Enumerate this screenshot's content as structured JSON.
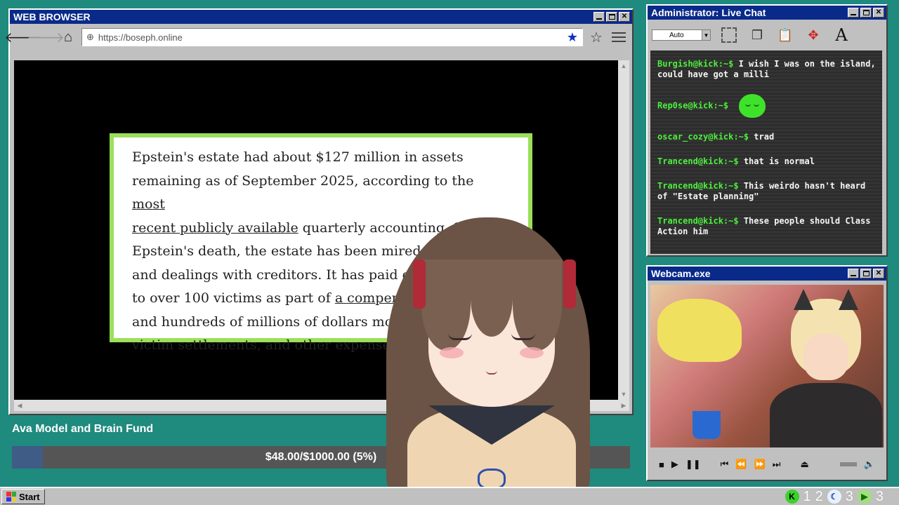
{
  "browser": {
    "title": "WEB BROWSER",
    "url": "https://boseph.online",
    "article": {
      "line1": "Epstein's estate had about $127 million in assets",
      "line2_a": "remaining as of September 2025, according to the ",
      "line2_link": "most",
      "line3_link": "recent publicly available",
      "line3_b": " quarterly accounting. Since",
      "line4": "Epstein's death, the estate has been mired in liti",
      "line5": "and dealings with creditors. It has paid ou",
      "line6_a": "to over 100 victims as part of ",
      "line6_link": "a compens",
      "line7": "and hundreds of millions of dollars mo",
      "line8": "victim settlements, and other expense"
    }
  },
  "chat": {
    "title": "Administrator: Live Chat",
    "select_value": "Auto",
    "messages": [
      {
        "user": "Burgish@kick:~$",
        "text": "I wish I was on the island, could have got a milli"
      },
      {
        "user": "Rep0se@kick:~$",
        "text": ""
      },
      {
        "user": "oscar_cozy@kick:~$",
        "text": "trad"
      },
      {
        "user": "Trancend@kick:~$",
        "text": "that is normal"
      },
      {
        "user": "Trancend@kick:~$",
        "text": "This weirdo hasn't heard of \"Estate planning\""
      },
      {
        "user": "Trancend@kick:~$",
        "text": "These people should Class Action him"
      }
    ]
  },
  "webcam": {
    "title": "Webcam.exe"
  },
  "fund": {
    "title": "Ava Model and Brain Fund",
    "progress_text": "$48.00/$1000.00 (5%)",
    "progress_fraction": 0.05,
    "colors": {
      "fill": "#3e5c86",
      "track": "#555555"
    }
  },
  "taskbar": {
    "start_label": "Start",
    "tray": [
      {
        "icon": "kick-icon",
        "count": "1"
      },
      {
        "icon": "moon-icon",
        "count": "2"
      },
      {
        "icon": "moon-icon",
        "count": "3"
      },
      {
        "icon": "play-icon",
        "count": "3"
      }
    ]
  },
  "colors": {
    "desktop": "#1f8a7e",
    "titlebar": "#0a2a8a",
    "chat_user": "#4cf03c"
  }
}
